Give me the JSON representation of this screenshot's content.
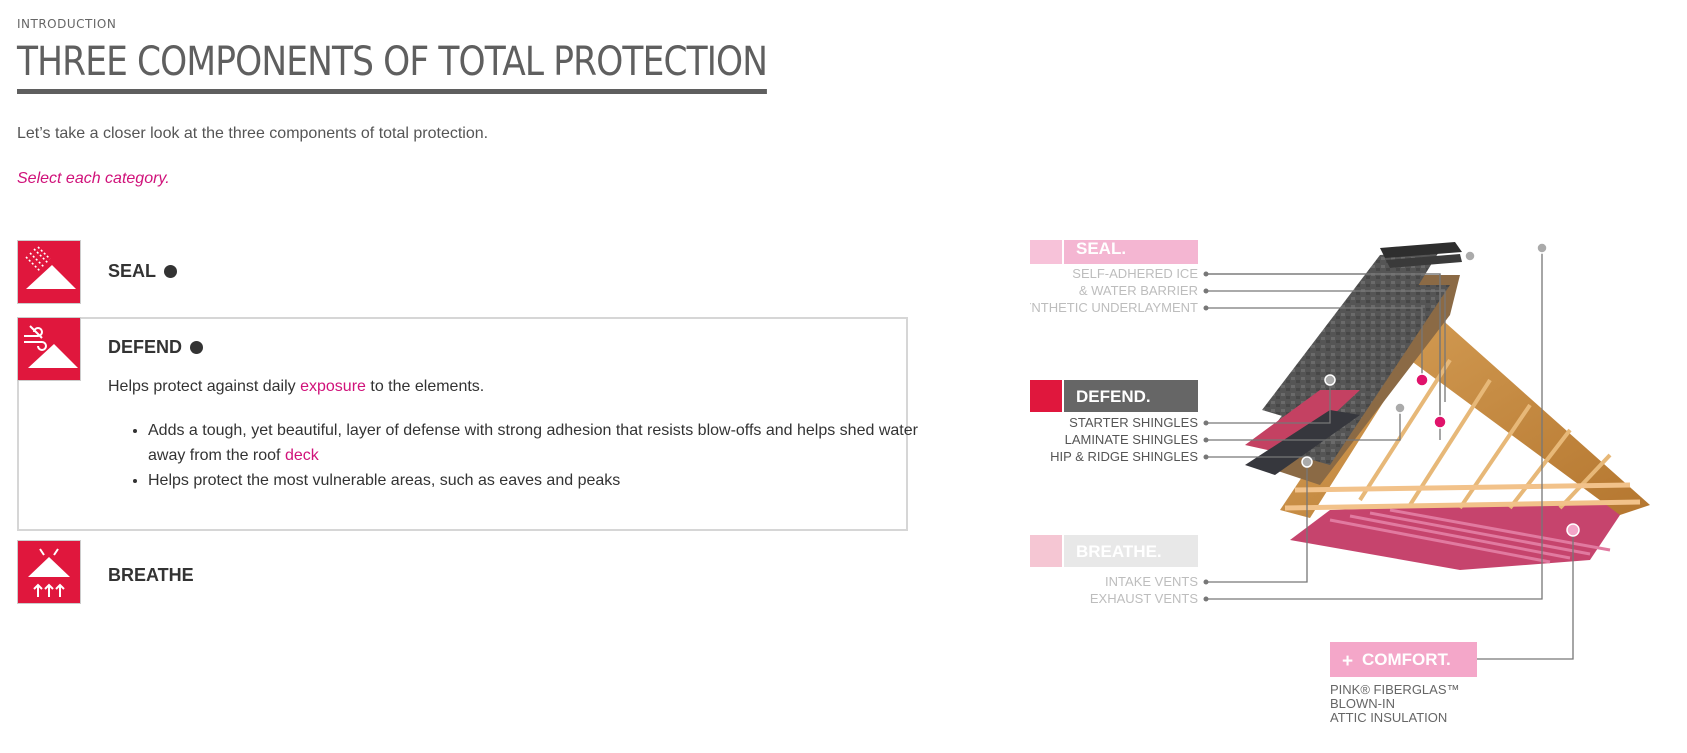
{
  "header": {
    "eyebrow": "INTRODUCTION",
    "title": "THREE COMPONENTS OF TOTAL PROTECTION",
    "intro": "Let’s take a closer look at the three components of total protection.",
    "instruction": "Select each category."
  },
  "categories": [
    {
      "label": "SEAL",
      "icon": "seal-icon",
      "completed": true
    },
    {
      "label": "DEFEND",
      "icon": "defend-icon",
      "completed": true
    },
    {
      "label": "BREATHE",
      "icon": "breathe-icon",
      "completed": false
    }
  ],
  "defend_panel": {
    "text_before": "Helps protect against daily ",
    "link1": "exposure",
    "text_after": " to the elements.",
    "bullet1_text": "Adds a tough, yet beautiful, layer of defense with strong adhesion that resists blow-offs and helps shed water away from the roof ",
    "bullet1_link": "deck",
    "bullet2_text": "Helps protect the most vulnerable areas, such as eaves and peaks"
  },
  "diagram": {
    "seal": {
      "title": "SEAL.",
      "items": [
        "SELF-ADHERED ICE",
        "& WATER BARRIER",
        "SYNTHETIC UNDERLAYMENT"
      ]
    },
    "defend": {
      "title": "DEFEND.",
      "items": [
        "STARTER SHINGLES",
        "LAMINATE SHINGLES",
        "HIP & RIDGE SHINGLES"
      ]
    },
    "breathe": {
      "title": "BREATHE.",
      "items": [
        "INTAKE VENTS",
        "EXHAUST VENTS"
      ]
    },
    "comfort": {
      "title": "COMFORT.",
      "items": [
        "PINK® FIBERGLAS™",
        "BLOWN-IN",
        "ATTIC INSULATION"
      ]
    }
  },
  "colors": {
    "accent": "#e0173d",
    "link": "#d0127a",
    "seal_label_bg": "#f4b6d2",
    "defend_label_bg": "#666666",
    "breathe_label_bg": "#e8e8e8",
    "comfort_label_bg": "#f4a7c9"
  }
}
